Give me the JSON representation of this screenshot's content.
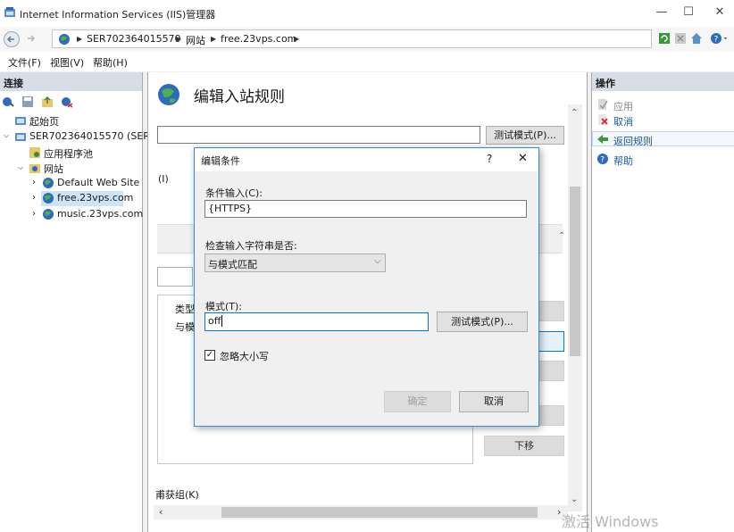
{
  "window": {
    "title": "Internet Information Services (IIS)管理器",
    "minimize": "—",
    "maximize": "☐",
    "close": "✕"
  },
  "address": {
    "crumbs": [
      "SER702364015570",
      "网站",
      "free.23vps.com"
    ]
  },
  "menu": {
    "items": [
      "文件(F)",
      "视图(V)",
      "帮助(H)"
    ]
  },
  "connections": {
    "title": "连接",
    "tree": [
      "起始页",
      "SER702364015570 (SER702",
      "应用程序池",
      "网站",
      "Default Web Site",
      "free.23vps.com",
      "music.23vps.com"
    ]
  },
  "main": {
    "heading": "编辑入站规则",
    "test_pattern_button": "测试模式(P)...",
    "fragment_paren": "(I)",
    "col_type": "类型",
    "col_match": "与模",
    "move_down_button": "下移",
    "capture_group_label": "甫获组(K)"
  },
  "actions": {
    "title": "操作",
    "items": [
      "应用",
      "取消",
      "返回规则",
      "帮助"
    ]
  },
  "dialog": {
    "title": "编辑条件",
    "help_glyph": "?",
    "close_glyph": "✕",
    "condition_input_label": "条件输入(C):",
    "condition_input_value": "{HTTPS}",
    "check_label": "检查输入字符串是否:",
    "check_value": "与模式匹配",
    "pattern_label": "模式(T):",
    "pattern_value": "off",
    "test_button": "测试模式(P)...",
    "ignore_case_label": "忽略大小写",
    "ok_button": "确定",
    "cancel_button": "取消"
  },
  "watermark": "激活 Windows"
}
